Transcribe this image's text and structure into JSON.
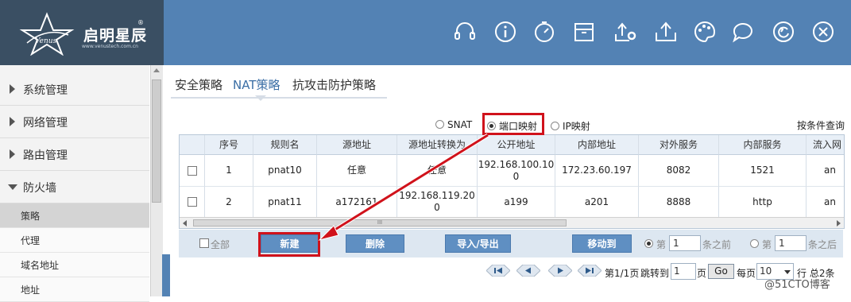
{
  "header": {
    "logo_text": "启明星辰",
    "logo_reg": "®",
    "logo_url": "www.venustech.com.cn",
    "logo_mark_text": "Venus",
    "icons": [
      "headset-icon",
      "info-icon",
      "timer-icon",
      "archive-icon",
      "upload-settings-icon",
      "upload-icon",
      "palette-icon",
      "chat-icon",
      "refresh-icon",
      "close-icon"
    ]
  },
  "sidebar": {
    "groups": [
      {
        "label": "系统管理",
        "expanded": false
      },
      {
        "label": "网络管理",
        "expanded": false
      },
      {
        "label": "路由管理",
        "expanded": false
      },
      {
        "label": "防火墙",
        "expanded": true
      }
    ],
    "subitems": [
      {
        "label": "策略",
        "active": true
      },
      {
        "label": "代理",
        "active": false
      },
      {
        "label": "域名地址",
        "active": false
      },
      {
        "label": "地址",
        "active": false
      }
    ]
  },
  "tabs": [
    {
      "label": "安全策略",
      "active": false
    },
    {
      "label": "NAT策略",
      "active": true
    },
    {
      "label": "抗攻击防护策略",
      "active": false
    }
  ],
  "nat_types": {
    "options": [
      "SNAT",
      "端口映射",
      "IP映射"
    ],
    "selected": "端口映射"
  },
  "condition_query": "按条件查询",
  "table": {
    "columns": [
      "序号",
      "规则名",
      "源地址",
      "源地址转换为",
      "公开地址",
      "内部地址",
      "对外服务",
      "内部服务",
      "流入网"
    ],
    "rows": [
      {
        "seq": "1",
        "name": "pnat10",
        "src": "任意",
        "src_trans": "任意",
        "public_l1": "192.168.100.10",
        "public_l2": "0",
        "internal": "172.23.60.197",
        "ext_svc": "8082",
        "int_svc": "1521",
        "inflow": "an"
      },
      {
        "seq": "2",
        "name": "pnat11",
        "src": "a172161",
        "src_trans_l1": "192.168.119.20",
        "src_trans_l2": "0",
        "public": "a199",
        "internal": "a201",
        "ext_svc": "8888",
        "int_svc": "http",
        "inflow": "an"
      }
    ],
    "scroll_grip": "III"
  },
  "actions": {
    "select_all": "全部",
    "new": "新建",
    "delete": "删除",
    "import_export": "导入/导出",
    "move_to": "移动到",
    "before_prefix": "第",
    "before_value": "1",
    "before_suffix": "条之前",
    "after_prefix": "第",
    "after_value": "1",
    "after_suffix": "条之后"
  },
  "pager": {
    "page_info": "第1/1页",
    "jump_to": "跳转到",
    "jump_value": "1",
    "page_unit": "页",
    "go": "Go",
    "per_page": "每页",
    "per_page_value": "10",
    "total": "行 总2条"
  },
  "watermark": "@51CTO博客",
  "colors": {
    "header_left": "#3a4f63",
    "header_right": "#5382b4",
    "button": "#5f8fc2",
    "highlight_red": "#d0121b"
  }
}
